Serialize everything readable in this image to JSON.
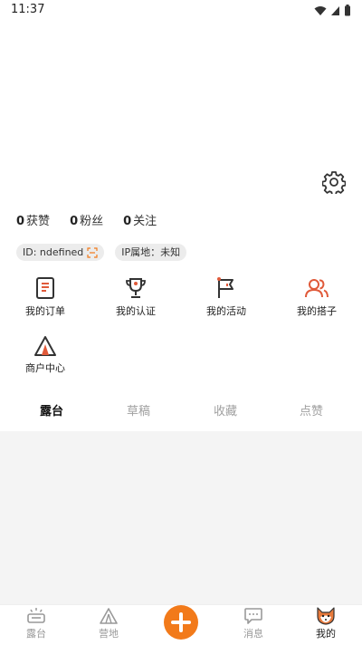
{
  "status_bar": {
    "time": "11:37"
  },
  "profile": {
    "stats": [
      {
        "num": "0",
        "label": "获赞"
      },
      {
        "num": "0",
        "label": "粉丝"
      },
      {
        "num": "0",
        "label": "关注"
      }
    ],
    "id_tag": "ID: ndefined",
    "ip_tag": "IP属地：未知"
  },
  "menu": [
    {
      "label": "我的订单",
      "icon": "order-icon"
    },
    {
      "label": "我的认证",
      "icon": "trophy-icon"
    },
    {
      "label": "我的活动",
      "icon": "flag-icon"
    },
    {
      "label": "我的搭子",
      "icon": "people-icon"
    },
    {
      "label": "商户中心",
      "icon": "tent-icon"
    }
  ],
  "tabs": [
    {
      "label": "露台",
      "active": true
    },
    {
      "label": "草稿",
      "active": false
    },
    {
      "label": "收藏",
      "active": false
    },
    {
      "label": "点赞",
      "active": false
    }
  ],
  "nav": [
    {
      "label": "露台",
      "icon": "terrace-icon"
    },
    {
      "label": "营地",
      "icon": "camp-icon"
    },
    {
      "label": "",
      "icon": "add-icon"
    },
    {
      "label": "消息",
      "icon": "message-icon"
    },
    {
      "label": "我的",
      "icon": "fox-icon",
      "active": true
    }
  ],
  "colors": {
    "accent": "#f27a1a",
    "icon_red": "#e05a3a"
  }
}
